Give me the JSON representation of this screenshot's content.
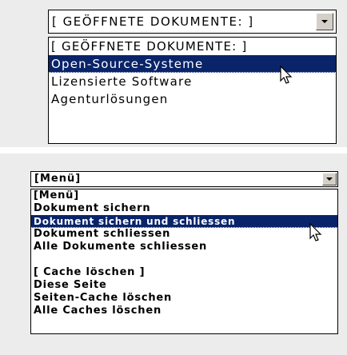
{
  "dropdown1": {
    "selected": "[ GEÖFFNETE DOKUMENTE: ]",
    "options": [
      {
        "label": "[ GEÖFFNETE DOKUMENTE: ]"
      },
      {
        "label": "Open-Source-Systeme"
      },
      {
        "label": "Lizensierte Software"
      },
      {
        "label": "Agenturlösungen"
      }
    ],
    "highlighted_option": "Open-Source-Systeme"
  },
  "dropdown2": {
    "selected": "[Menü]",
    "options": [
      {
        "label": "[Menü]"
      },
      {
        "label": "Dokument sichern"
      },
      {
        "label": "Dokument sichern und schliessen"
      },
      {
        "label": "Dokument schliessen"
      },
      {
        "label": "Alle Dokumente schliessen"
      },
      {
        "label": ""
      },
      {
        "label": "[ Cache löschen ]"
      },
      {
        "label": "Diese Seite"
      },
      {
        "label": "Seiten-Cache löschen"
      },
      {
        "label": "Alle Caches löschen"
      }
    ],
    "highlighted_option": "Dokument sichern und schliessen"
  },
  "colors": {
    "highlight_bg": "#0a246a",
    "panel_bg": "#ececec",
    "button_face": "#d4d0c8"
  },
  "icons": {
    "cursor": "arrow-cursor-icon",
    "dropdown_button": "chevron-down-icon"
  }
}
